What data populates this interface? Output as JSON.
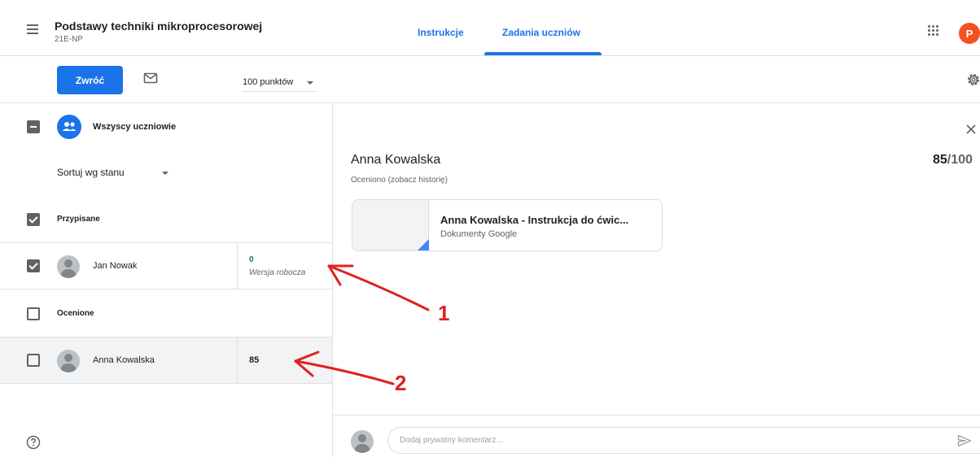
{
  "header": {
    "course_title": "Podstawy techniki mikroprocesorowej",
    "course_subtitle": "21E-NP",
    "tabs": [
      {
        "label": "Instrukcje"
      },
      {
        "label": "Zadania uczniów",
        "active": true
      }
    ],
    "account_initial": "P"
  },
  "toolbar": {
    "return_label": "Zwróć",
    "points_value": "100 punktów"
  },
  "left": {
    "all_students_label": "Wszyscy uczniowie",
    "sort_label": "Sortuj wg stanu",
    "sections": [
      {
        "label": "Przypisane",
        "checked": true,
        "students": [
          {
            "name": "Jan Nowak",
            "grade": "0",
            "grade_note": "Wersja robocza",
            "checked": true
          }
        ]
      },
      {
        "label": "Ocenione",
        "checked": false,
        "students": [
          {
            "name": "Anna Kowalska",
            "grade": "85",
            "checked": false,
            "selected": true
          }
        ]
      }
    ]
  },
  "detail": {
    "student_name": "Anna Kowalska",
    "score": "85",
    "score_max": "/100",
    "status": "Oceniono (zobacz historię)",
    "attachment": {
      "title": "Anna Kowalska - Instrukcja do ćwic...",
      "type": "Dokumenty Google"
    },
    "comment_placeholder": "Dodaj prywatny komentarz..."
  },
  "annotations": [
    {
      "label": "1"
    },
    {
      "label": "2"
    }
  ],
  "colors": {
    "accent": "#1a73e8",
    "avatar": "#f4511e",
    "draft_grade": "#188038",
    "annotation": "#e02020"
  },
  "icons": [
    "hamburger-icon",
    "apps-icon",
    "mail-icon",
    "gear-icon",
    "people-icon",
    "close-icon",
    "help-icon",
    "send-icon",
    "docs-icon"
  ]
}
